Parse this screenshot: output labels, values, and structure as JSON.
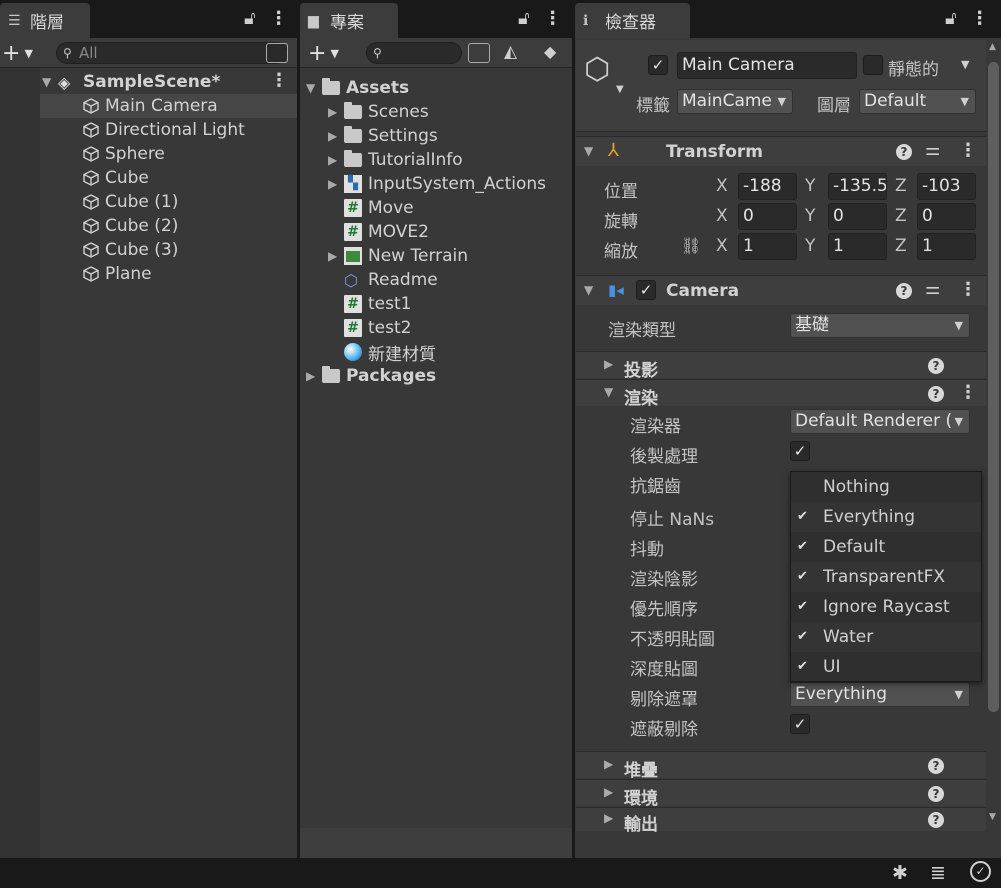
{
  "hierarchy": {
    "tab_label": "階層",
    "search_placeholder": "All",
    "scene_name": "SampleScene*",
    "items": [
      "Main Camera",
      "Directional Light",
      "Sphere",
      "Cube",
      "Cube (1)",
      "Cube (2)",
      "Cube (3)",
      "Plane"
    ]
  },
  "project": {
    "tab_label": "專案",
    "root": "Assets",
    "assets": [
      {
        "name": "Scenes",
        "kind": "folder"
      },
      {
        "name": "Settings",
        "kind": "folder"
      },
      {
        "name": "TutorialInfo",
        "kind": "folder"
      },
      {
        "name": "InputSystem_Actions",
        "kind": "input-actions"
      },
      {
        "name": "Move",
        "kind": "script"
      },
      {
        "name": "MOVE2",
        "kind": "script"
      },
      {
        "name": "New Terrain",
        "kind": "terrain"
      },
      {
        "name": "Readme",
        "kind": "readme"
      },
      {
        "name": "test1",
        "kind": "script"
      },
      {
        "name": "test2",
        "kind": "script"
      },
      {
        "name": "新建材質",
        "kind": "material"
      }
    ],
    "packages": "Packages"
  },
  "inspector": {
    "tab_label": "檢查器",
    "object_name": "Main Camera",
    "static_label": "靜態的",
    "tag_label": "標籤",
    "tag_value": "MainCame",
    "layer_label": "圖層",
    "layer_value": "Default",
    "transform": {
      "title": "Transform",
      "position_label": "位置",
      "rotation_label": "旋轉",
      "scale_label": "縮放",
      "position": {
        "x": "-188",
        "y": "-135.5",
        "z": "-103"
      },
      "rotation": {
        "x": "0",
        "y": "0",
        "z": "0"
      },
      "scale": {
        "x": "1",
        "y": "1",
        "z": "1"
      }
    },
    "camera": {
      "title": "Camera",
      "render_type_label": "渲染類型",
      "render_type_value": "基礎",
      "projection_label": "投影",
      "rendering_label": "渲染",
      "renderer_label": "渲染器",
      "renderer_value": "Default Renderer (",
      "post_processing_label": "後製處理",
      "anti_aliasing_label": "抗鋸齒",
      "stop_nans_label": "停止 NaNs",
      "dithering_label": "抖動",
      "render_shadows_label": "渲染陰影",
      "priority_label": "優先順序",
      "opaque_texture_label": "不透明貼圖",
      "depth_texture_label": "深度貼圖",
      "culling_mask_label": "剔除遮罩",
      "culling_mask_value": "Everything",
      "occlusion_culling_label": "遮蔽剔除",
      "stack_label": "堆疊",
      "environment_label": "環境",
      "output_label": "輸出"
    }
  },
  "layer_popup": {
    "items": [
      {
        "label": "Nothing",
        "checked": false
      },
      {
        "label": "Everything",
        "checked": true
      },
      {
        "label": "Default",
        "checked": true
      },
      {
        "label": "TransparentFX",
        "checked": true
      },
      {
        "label": "Ignore Raycast",
        "checked": true
      },
      {
        "label": "Water",
        "checked": true
      },
      {
        "label": "UI",
        "checked": true
      }
    ]
  },
  "axes": {
    "x": "X",
    "y": "Y",
    "z": "Z"
  },
  "colors": {
    "accent_blue": "#4a8fe0",
    "panel_bg": "#383838",
    "dark_bg": "#191919"
  }
}
